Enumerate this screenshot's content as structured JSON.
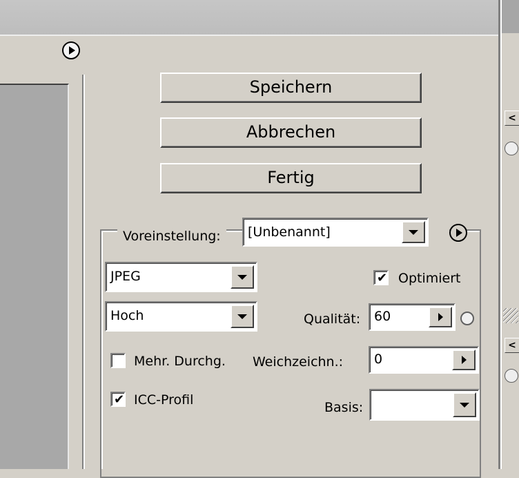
{
  "buttons": {
    "save": "Speichern",
    "cancel": "Abbrechen",
    "done": "Fertig"
  },
  "preset": {
    "label": "Voreinstellung:",
    "value": "[Unbenannt]"
  },
  "format": {
    "value": "JPEG"
  },
  "quality_preset": {
    "value": "Hoch"
  },
  "optimized": {
    "label": "Optimiert",
    "checked": true
  },
  "quality": {
    "label": "Qualität:",
    "value": "60"
  },
  "progressive": {
    "label": "Mehr. Durchg.",
    "checked": false
  },
  "blur": {
    "label": "Weichzeichn.:",
    "value": "0"
  },
  "icc": {
    "label": "ICC-Profil",
    "checked": true
  },
  "matte": {
    "label": "Basis:",
    "value": ""
  },
  "right_strip": {
    "btn1": "<",
    "btn2": "<"
  },
  "icons": [
    "menu-arrow-icon",
    "dropdown-arrow-icon",
    "checkmark-icon",
    "spin-arrow-icon",
    "eyedropper-circle-icon"
  ]
}
